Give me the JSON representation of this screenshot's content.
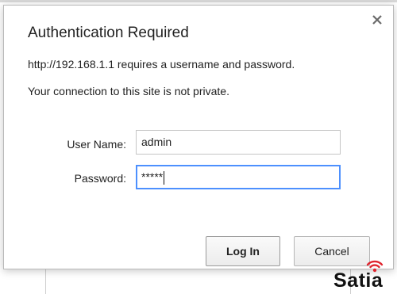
{
  "dialog": {
    "title": "Authentication Required",
    "message_line1": "http://192.168.1.1 requires a username and password.",
    "message_line2": "Your connection to this site is not private.",
    "close_icon": "close-icon",
    "username": {
      "label": "User Name:",
      "value": "admin"
    },
    "password": {
      "label": "Password:",
      "value": "*****"
    },
    "buttons": {
      "login_label": "Log In",
      "cancel_label": "Cancel"
    }
  },
  "watermark": {
    "text": "Satia",
    "icon": "wifi-signal-icon",
    "accent_color": "#e0252f"
  }
}
